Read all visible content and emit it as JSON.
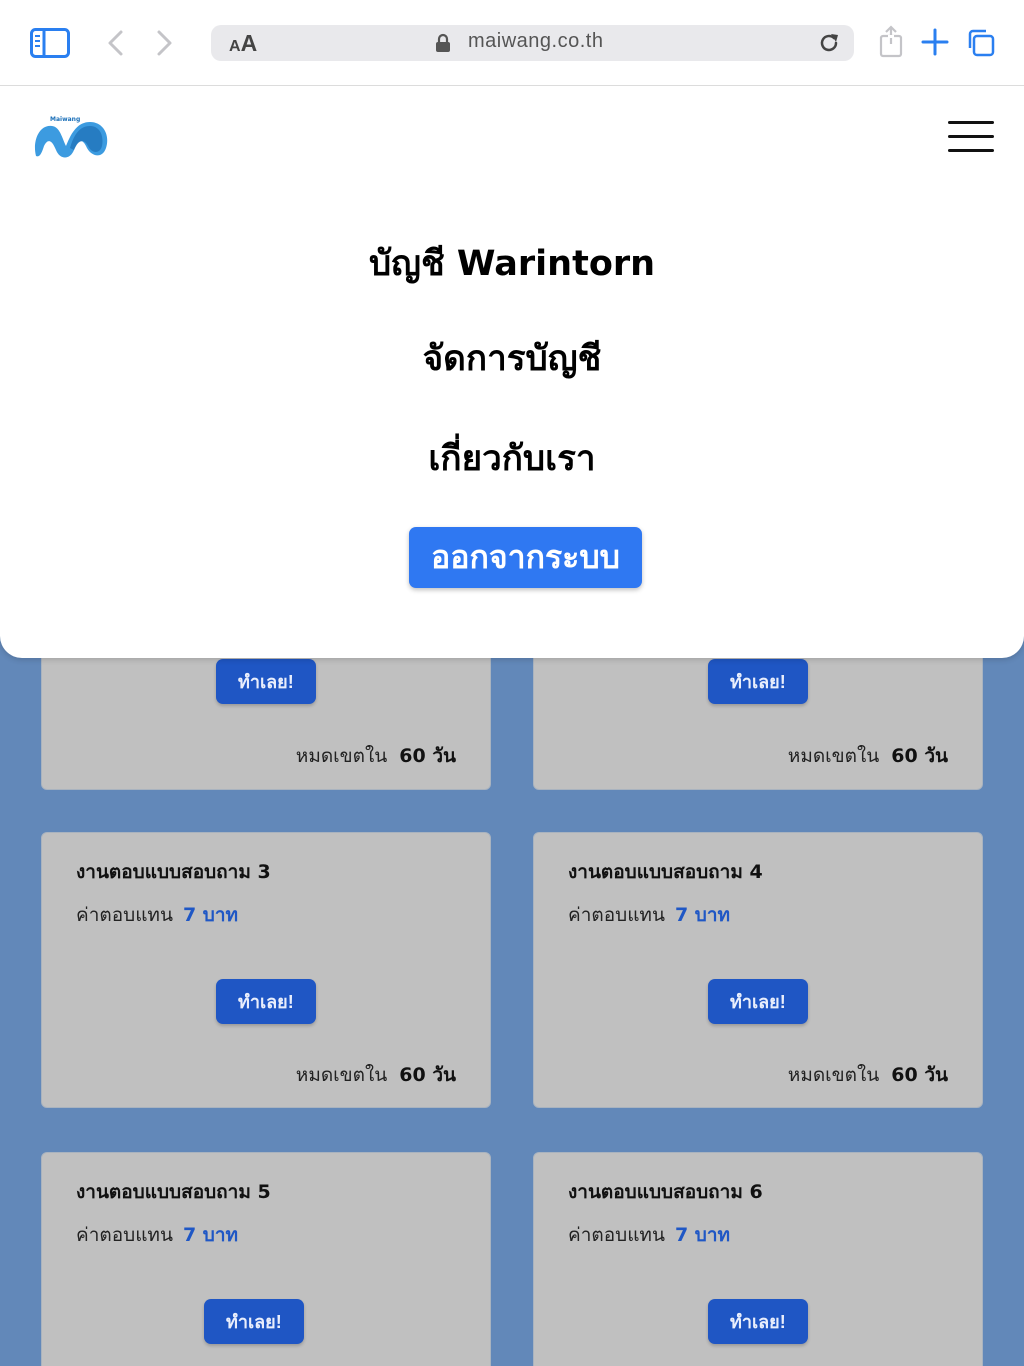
{
  "browser": {
    "aa_small": "A",
    "aa_big": "A",
    "url": "maiwang.co.th"
  },
  "menu": {
    "logo_text": "Maiwang",
    "items": [
      "บัญชี Warintorn",
      "จัดการบัญชี",
      "เกี่ยวกับเรา"
    ],
    "logout_label": "ออกจากระบบ"
  },
  "cards": [
    {
      "title": "",
      "reward_label": "",
      "reward_value": "",
      "button": "ทำเลย!",
      "expire_label": "หมดเขตใน",
      "expire_value": "60 วัน"
    },
    {
      "title": "",
      "reward_label": "",
      "reward_value": "",
      "button": "ทำเลย!",
      "expire_label": "หมดเขตใน",
      "expire_value": "60 วัน"
    },
    {
      "title": "งานตอบแบบสอบถาม 3",
      "reward_label": "ค่าตอบแทน",
      "reward_value": "7 บาท",
      "button": "ทำเลย!",
      "expire_label": "หมดเขตใน",
      "expire_value": "60 วัน"
    },
    {
      "title": "งานตอบแบบสอบถาม 4",
      "reward_label": "ค่าตอบแทน",
      "reward_value": "7 บาท",
      "button": "ทำเลย!",
      "expire_label": "หมดเขตใน",
      "expire_value": "60 วัน"
    },
    {
      "title": "งานตอบแบบสอบถาม  5",
      "reward_label": "ค่าตอบแทน",
      "reward_value": "7 บาท",
      "button": "ทำเลย!",
      "expire_label": "",
      "expire_value": ""
    },
    {
      "title": "งานตอบแบบสอบถาม 6",
      "reward_label": "ค่าตอบแทน",
      "reward_value": "7 บาท",
      "button": "ทำเลย!",
      "expire_label": "",
      "expire_value": ""
    }
  ],
  "colors": {
    "page_bg": "#6288b9",
    "card_bg": "#c0c0c0",
    "button_blue": "#1f56c4",
    "logout_blue": "#2f78f2",
    "reward_blue": "#1f57c5",
    "browser_accent": "#2a7ff0"
  }
}
